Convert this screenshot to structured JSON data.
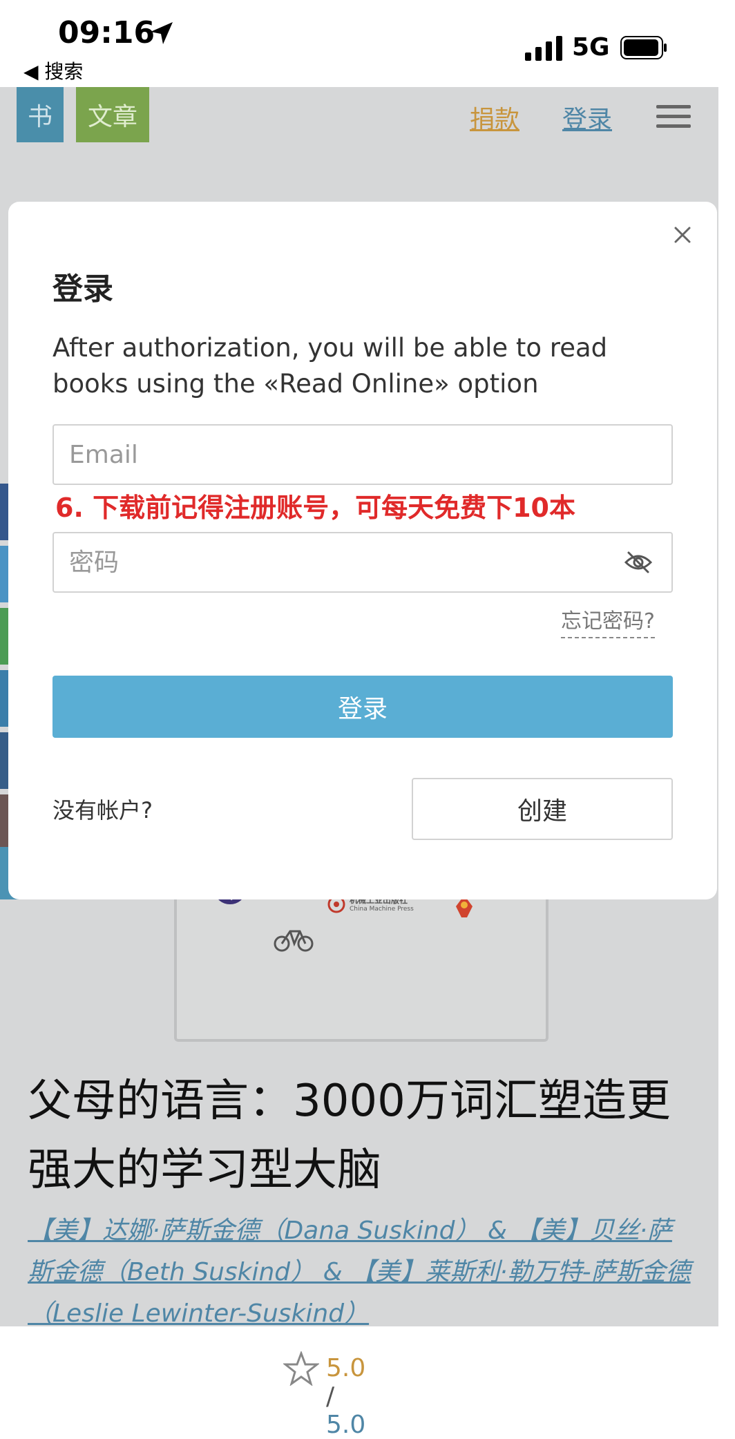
{
  "status_bar": {
    "time": "09:16",
    "back_label": "◀ 搜索",
    "network": "5G"
  },
  "header": {
    "tab_book": "书",
    "tab_articles": "文章",
    "donate": "捐款",
    "login": "登录"
  },
  "modal": {
    "title": "登录",
    "description": "After authorization, you will be able to read books using the «Read Online» option",
    "email_placeholder": "Email",
    "annotation": "6. 下载前记得注册账号，可每天免费下10本",
    "password_placeholder": "密码",
    "forgot_password": "忘记密码?",
    "login_button": "登录",
    "no_account": "没有帐户?",
    "create_button": "创建"
  },
  "book": {
    "press_name_cn": "机械工业出版社",
    "press_name_en": "China Machine Press",
    "title": "父母的语言：3000万词汇塑造更强大的学习型大脑",
    "authors": "【美】达娜·萨斯金德（Dana Suskind） & 【美】贝丝·萨斯金德（Beth Suskind） & 【美】莱斯利·勒万特-萨斯金德（Leslie Lewinter-Suskind）",
    "rating": "5.0",
    "rating_max": "5.0"
  },
  "colors": {
    "tab_book": "#4a8eaa",
    "tab_articles": "#7ba44d",
    "donate": "#c8953d",
    "link": "#4f86a6",
    "primary_button": "#5aaed4",
    "annotation": "#e02a2a"
  }
}
